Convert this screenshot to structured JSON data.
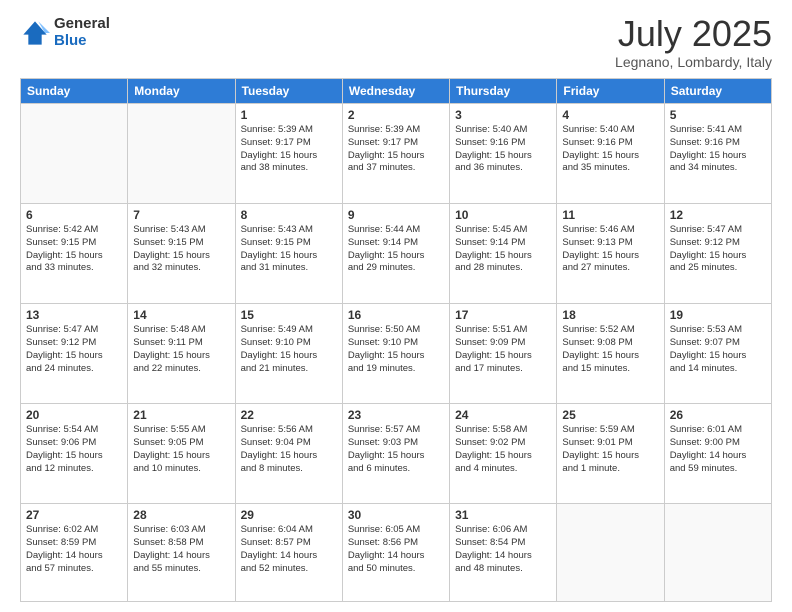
{
  "header": {
    "logo_general": "General",
    "logo_blue": "Blue",
    "month": "July 2025",
    "location": "Legnano, Lombardy, Italy"
  },
  "weekdays": [
    "Sunday",
    "Monday",
    "Tuesday",
    "Wednesday",
    "Thursday",
    "Friday",
    "Saturday"
  ],
  "weeks": [
    [
      {
        "day": "",
        "details": ""
      },
      {
        "day": "",
        "details": ""
      },
      {
        "day": "1",
        "details": "Sunrise: 5:39 AM\nSunset: 9:17 PM\nDaylight: 15 hours\nand 38 minutes."
      },
      {
        "day": "2",
        "details": "Sunrise: 5:39 AM\nSunset: 9:17 PM\nDaylight: 15 hours\nand 37 minutes."
      },
      {
        "day": "3",
        "details": "Sunrise: 5:40 AM\nSunset: 9:16 PM\nDaylight: 15 hours\nand 36 minutes."
      },
      {
        "day": "4",
        "details": "Sunrise: 5:40 AM\nSunset: 9:16 PM\nDaylight: 15 hours\nand 35 minutes."
      },
      {
        "day": "5",
        "details": "Sunrise: 5:41 AM\nSunset: 9:16 PM\nDaylight: 15 hours\nand 34 minutes."
      }
    ],
    [
      {
        "day": "6",
        "details": "Sunrise: 5:42 AM\nSunset: 9:15 PM\nDaylight: 15 hours\nand 33 minutes."
      },
      {
        "day": "7",
        "details": "Sunrise: 5:43 AM\nSunset: 9:15 PM\nDaylight: 15 hours\nand 32 minutes."
      },
      {
        "day": "8",
        "details": "Sunrise: 5:43 AM\nSunset: 9:15 PM\nDaylight: 15 hours\nand 31 minutes."
      },
      {
        "day": "9",
        "details": "Sunrise: 5:44 AM\nSunset: 9:14 PM\nDaylight: 15 hours\nand 29 minutes."
      },
      {
        "day": "10",
        "details": "Sunrise: 5:45 AM\nSunset: 9:14 PM\nDaylight: 15 hours\nand 28 minutes."
      },
      {
        "day": "11",
        "details": "Sunrise: 5:46 AM\nSunset: 9:13 PM\nDaylight: 15 hours\nand 27 minutes."
      },
      {
        "day": "12",
        "details": "Sunrise: 5:47 AM\nSunset: 9:12 PM\nDaylight: 15 hours\nand 25 minutes."
      }
    ],
    [
      {
        "day": "13",
        "details": "Sunrise: 5:47 AM\nSunset: 9:12 PM\nDaylight: 15 hours\nand 24 minutes."
      },
      {
        "day": "14",
        "details": "Sunrise: 5:48 AM\nSunset: 9:11 PM\nDaylight: 15 hours\nand 22 minutes."
      },
      {
        "day": "15",
        "details": "Sunrise: 5:49 AM\nSunset: 9:10 PM\nDaylight: 15 hours\nand 21 minutes."
      },
      {
        "day": "16",
        "details": "Sunrise: 5:50 AM\nSunset: 9:10 PM\nDaylight: 15 hours\nand 19 minutes."
      },
      {
        "day": "17",
        "details": "Sunrise: 5:51 AM\nSunset: 9:09 PM\nDaylight: 15 hours\nand 17 minutes."
      },
      {
        "day": "18",
        "details": "Sunrise: 5:52 AM\nSunset: 9:08 PM\nDaylight: 15 hours\nand 15 minutes."
      },
      {
        "day": "19",
        "details": "Sunrise: 5:53 AM\nSunset: 9:07 PM\nDaylight: 15 hours\nand 14 minutes."
      }
    ],
    [
      {
        "day": "20",
        "details": "Sunrise: 5:54 AM\nSunset: 9:06 PM\nDaylight: 15 hours\nand 12 minutes."
      },
      {
        "day": "21",
        "details": "Sunrise: 5:55 AM\nSunset: 9:05 PM\nDaylight: 15 hours\nand 10 minutes."
      },
      {
        "day": "22",
        "details": "Sunrise: 5:56 AM\nSunset: 9:04 PM\nDaylight: 15 hours\nand 8 minutes."
      },
      {
        "day": "23",
        "details": "Sunrise: 5:57 AM\nSunset: 9:03 PM\nDaylight: 15 hours\nand 6 minutes."
      },
      {
        "day": "24",
        "details": "Sunrise: 5:58 AM\nSunset: 9:02 PM\nDaylight: 15 hours\nand 4 minutes."
      },
      {
        "day": "25",
        "details": "Sunrise: 5:59 AM\nSunset: 9:01 PM\nDaylight: 15 hours\nand 1 minute."
      },
      {
        "day": "26",
        "details": "Sunrise: 6:01 AM\nSunset: 9:00 PM\nDaylight: 14 hours\nand 59 minutes."
      }
    ],
    [
      {
        "day": "27",
        "details": "Sunrise: 6:02 AM\nSunset: 8:59 PM\nDaylight: 14 hours\nand 57 minutes."
      },
      {
        "day": "28",
        "details": "Sunrise: 6:03 AM\nSunset: 8:58 PM\nDaylight: 14 hours\nand 55 minutes."
      },
      {
        "day": "29",
        "details": "Sunrise: 6:04 AM\nSunset: 8:57 PM\nDaylight: 14 hours\nand 52 minutes."
      },
      {
        "day": "30",
        "details": "Sunrise: 6:05 AM\nSunset: 8:56 PM\nDaylight: 14 hours\nand 50 minutes."
      },
      {
        "day": "31",
        "details": "Sunrise: 6:06 AM\nSunset: 8:54 PM\nDaylight: 14 hours\nand 48 minutes."
      },
      {
        "day": "",
        "details": ""
      },
      {
        "day": "",
        "details": ""
      }
    ]
  ]
}
